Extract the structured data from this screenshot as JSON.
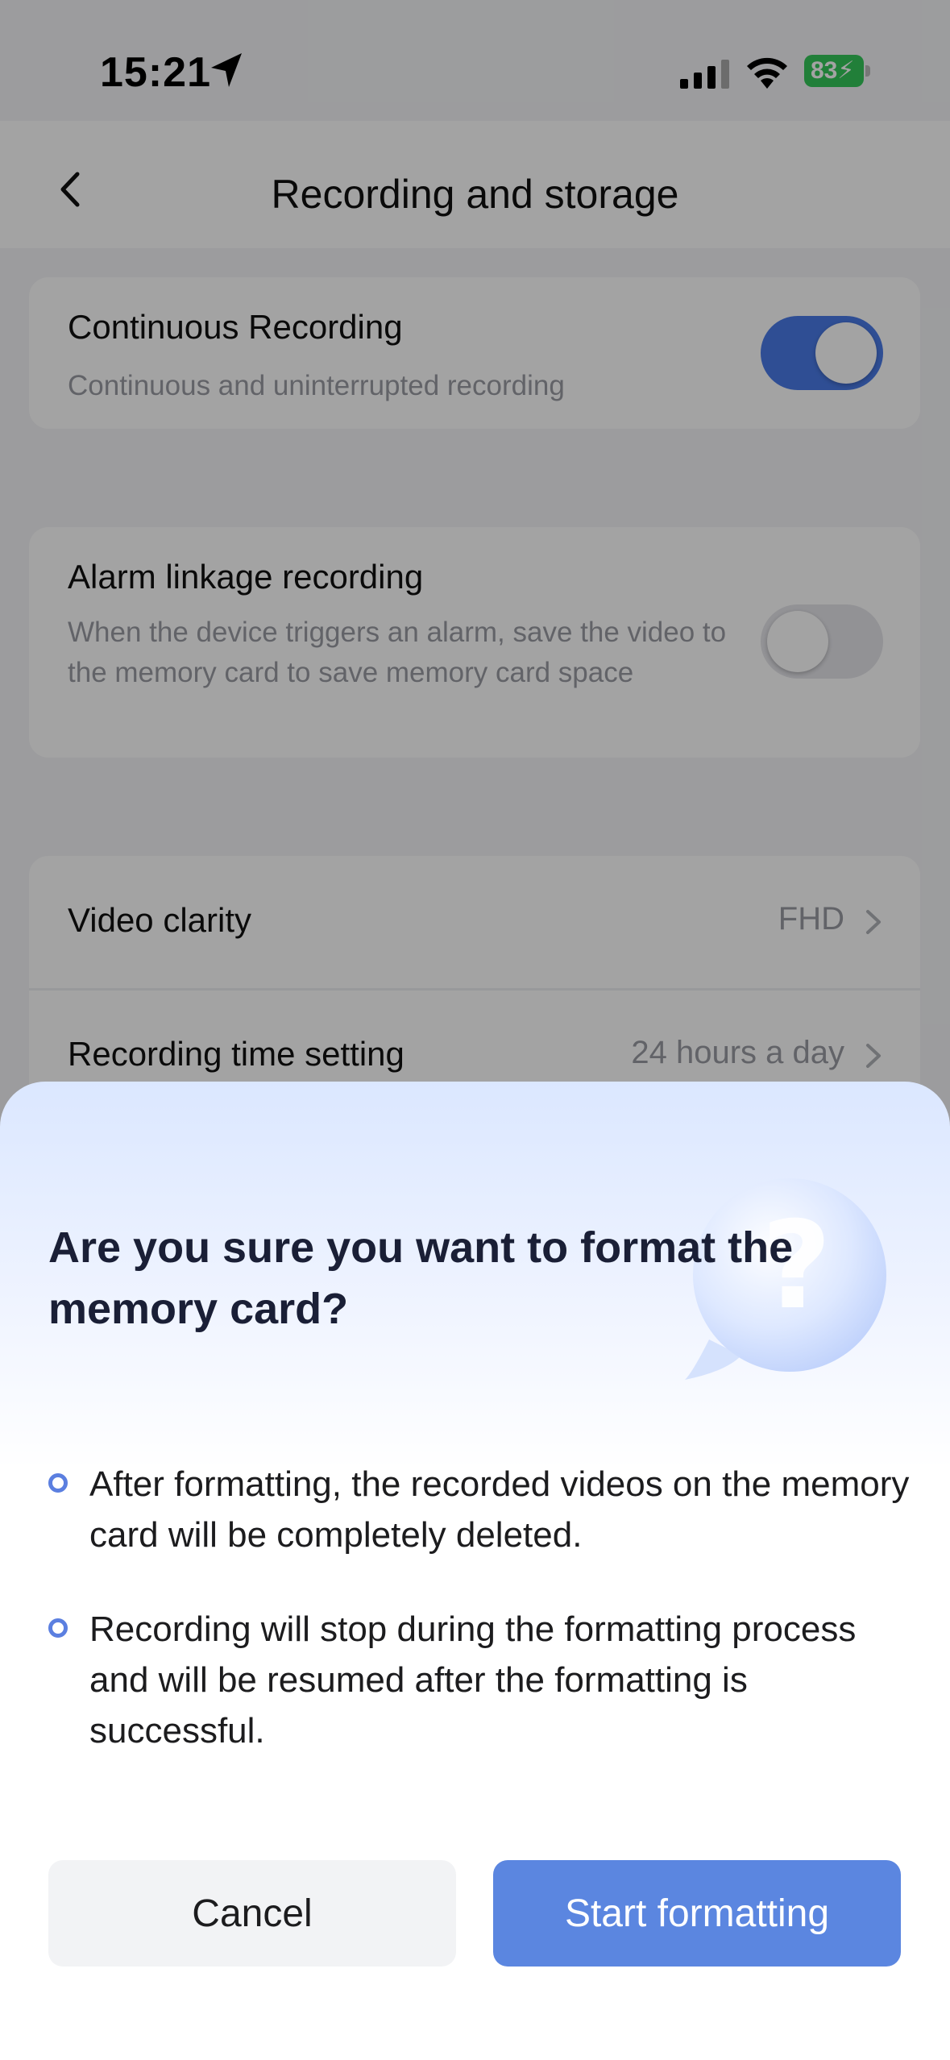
{
  "status_bar": {
    "time": "15:21",
    "battery": "83",
    "icons": [
      "location-arrow-icon",
      "cellular-signal-icon",
      "wifi-icon",
      "battery-charging-icon"
    ]
  },
  "nav": {
    "title": "Recording and storage",
    "back_icon": "chevron-left-icon"
  },
  "settings": {
    "continuous": {
      "title": "Continuous Recording",
      "description": "Continuous and uninterrupted recording",
      "enabled": true
    },
    "alarm": {
      "title": "Alarm linkage recording",
      "description": "When the device triggers an alarm, save the video to the memory card to save memory card space",
      "enabled": false
    },
    "rows": [
      {
        "label": "Video clarity",
        "value": "FHD"
      },
      {
        "label": "Recording time setting",
        "value": "24 hours a day"
      }
    ]
  },
  "dialog": {
    "title": "Are you sure you want to format the memory card?",
    "bullets": [
      "After formatting, the recorded videos on the memory card will be completely deleted.",
      "Recording will stop during the formatting process and will be resumed after the formatting is successful."
    ],
    "cancel_label": "Cancel",
    "confirm_label": "Start formatting",
    "decor_icon": "question-mark-bubble-icon"
  },
  "colors": {
    "accent": "#5b86e0",
    "toggle_on": "#4a7be8",
    "toggle_off": "#e5e5ea",
    "battery": "#34c759"
  }
}
